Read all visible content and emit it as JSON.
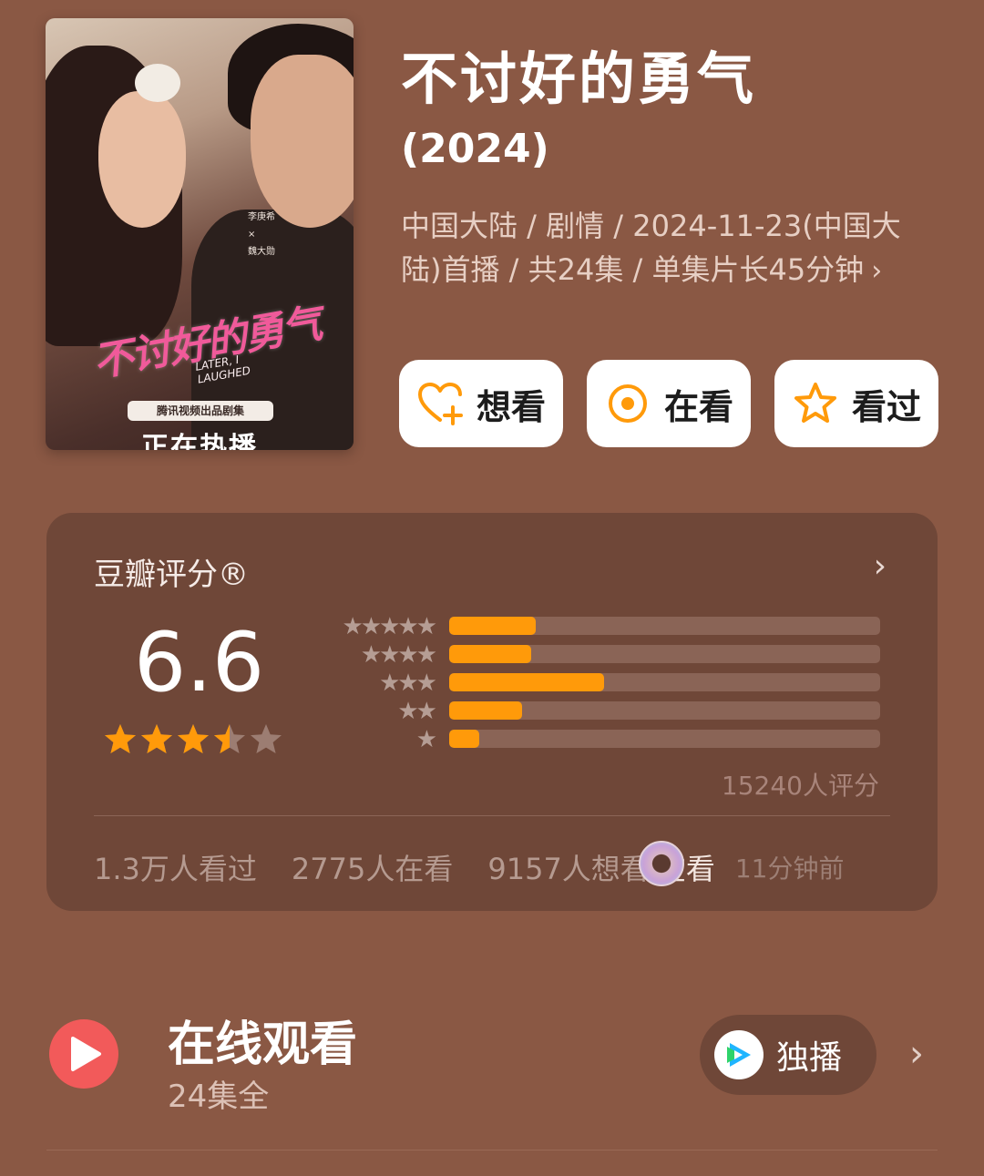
{
  "poster": {
    "cast_1": "李庚希",
    "cast_2": "魏大勋",
    "cast_x": "×",
    "logo_text": "不讨好的勇气",
    "english_title": "LATER, I LAUGHED",
    "tag": "腾讯视频出品剧集",
    "status": "正在热播"
  },
  "title": "不讨好的勇气",
  "year": "(2024)",
  "meta": "中国大陆 / 剧情 / 2024-11-23(中国大陆)首播 / 共24集 / 单集片长45分钟",
  "actions": [
    {
      "label": "想看",
      "icon": "heart-plus-icon"
    },
    {
      "label": "在看",
      "icon": "target-circle-icon"
    },
    {
      "label": "看过",
      "icon": "star-outline-icon"
    }
  ],
  "rating": {
    "header": "豆瓣评分®",
    "score": "6.6",
    "stars_filled": 3.5,
    "stars_total": 5,
    "distribution": [
      {
        "stars": 5,
        "label": "★★★★★",
        "fraction": 0.2
      },
      {
        "stars": 4,
        "label": "★★★★",
        "fraction": 0.19
      },
      {
        "stars": 3,
        "label": "★★★",
        "fraction": 0.36
      },
      {
        "stars": 2,
        "label": "★★",
        "fraction": 0.17
      },
      {
        "stars": 1,
        "label": "★",
        "fraction": 0.07
      }
    ],
    "votes": "15240人评分",
    "stats": {
      "watched": "1.3万人看过",
      "watching": "2775人在看",
      "want": "9157人想看",
      "now_watching": "在看",
      "ago": "11分钟前"
    }
  },
  "online": {
    "title": "在线观看",
    "subtitle": "24集全",
    "platform_label": "独播",
    "platform_icon": "tencent-video-icon"
  },
  "colors": {
    "background": "#8a5844",
    "card": "#6f4738",
    "bar_fill": "#ff9a0a",
    "star": "#ff9a0a",
    "play": "#f25a5a"
  }
}
